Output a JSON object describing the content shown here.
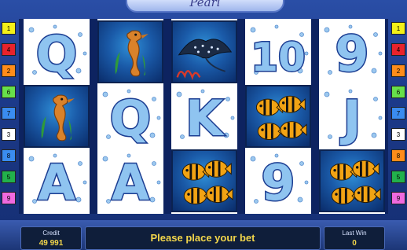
{
  "game": {
    "title": "Pearl"
  },
  "reels": [
    [
      "Q",
      "seahorse",
      "A"
    ],
    [
      "seahorse",
      "Q",
      "A"
    ],
    [
      "manta-ray",
      "K",
      "fish"
    ],
    [
      "10",
      "fish",
      "9"
    ],
    [
      "9",
      "J",
      "fish"
    ]
  ],
  "paylines": {
    "left": [
      {
        "label": "1",
        "color": "#f3f018"
      },
      {
        "label": "4",
        "color": "#e8232b"
      },
      {
        "label": "2",
        "color": "#ff8c1a"
      },
      {
        "label": "6",
        "color": "#67e04a"
      },
      {
        "label": "7",
        "color": "#3a8cf0"
      },
      {
        "label": "3",
        "color": "#ffffff"
      },
      {
        "label": "8",
        "color": "#3a8cf0"
      },
      {
        "label": "5",
        "color": "#22b14c"
      },
      {
        "label": "9",
        "color": "#f06adf"
      }
    ],
    "right": [
      {
        "label": "1",
        "color": "#f3f018"
      },
      {
        "label": "4",
        "color": "#e8232b"
      },
      {
        "label": "2",
        "color": "#ff8c1a"
      },
      {
        "label": "6",
        "color": "#67e04a"
      },
      {
        "label": "7",
        "color": "#3a8cf0"
      },
      {
        "label": "3",
        "color": "#ffffff"
      },
      {
        "label": "8",
        "color": "#ff8c1a"
      },
      {
        "label": "5",
        "color": "#22b14c"
      },
      {
        "label": "9",
        "color": "#f06adf"
      }
    ]
  },
  "panel": {
    "credit_label": "Credit",
    "credit_value": "49 991",
    "message": "Please place your bet",
    "lastwin_label": "Last Win",
    "lastwin_value": "0"
  }
}
